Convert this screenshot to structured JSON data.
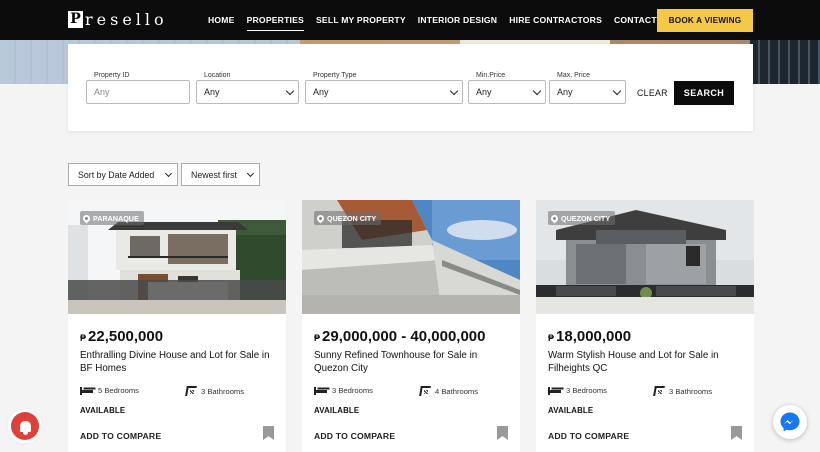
{
  "header": {
    "logo": {
      "initial": "P",
      "rest": "resello"
    },
    "nav": [
      {
        "label": "HOME",
        "active": false
      },
      {
        "label": "PROPERTIES",
        "active": true
      },
      {
        "label": "SELL MY PROPERTY",
        "active": false
      },
      {
        "label": "INTERIOR DESIGN",
        "active": false
      },
      {
        "label": "HIRE CONTRACTORS",
        "active": false
      },
      {
        "label": "CONTACT US",
        "active": false
      }
    ],
    "cta_label": "BOOK A VIEWING",
    "cta_color": "#f5c845"
  },
  "search": {
    "property_id": {
      "label": "Property ID",
      "placeholder": "Any"
    },
    "location": {
      "label": "Location",
      "value": "Any"
    },
    "property_type": {
      "label": "Property Type",
      "value": "Any"
    },
    "min_price": {
      "label": "Min.Price",
      "value": "Any"
    },
    "max_price": {
      "label": "Max. Price",
      "value": "Any"
    },
    "clear_label": "CLEAR",
    "search_label": "SEARCH"
  },
  "sorting": {
    "sort_by": "Sort by Date Added",
    "order": "Newest first"
  },
  "currency_symbol": "₱",
  "listings": [
    {
      "location": "PARANAQUE",
      "price": "22,500,000",
      "title": "Enthralling Divine House and Lot for Sale in BF Homes",
      "bedrooms": "5 Bedrooms",
      "bathrooms": "3 Bathrooms",
      "status": "AVAILABLE",
      "compare_label": "ADD TO COMPARE"
    },
    {
      "location": "QUEZON CITY",
      "price": "29,000,000 - 40,000,000",
      "title": "Sunny Refined Townhouse for Sale in Quezon City",
      "bedrooms": "3 Bedrooms",
      "bathrooms": "4 Bathrooms",
      "status": "AVAILABLE",
      "compare_label": "ADD TO COMPARE"
    },
    {
      "location": "QUEZON CITY",
      "price": "18,000,000",
      "title": "Warm Stylish House and Lot for Sale in Filheights QC",
      "bedrooms": "3 Bedrooms",
      "bathrooms": "3 Bathrooms",
      "status": "AVAILABLE",
      "compare_label": "ADD TO COMPARE"
    }
  ],
  "widgets": {
    "notification_icon": "bell-icon",
    "chat_icon": "messenger-icon",
    "chat_color": "#1877f2"
  }
}
